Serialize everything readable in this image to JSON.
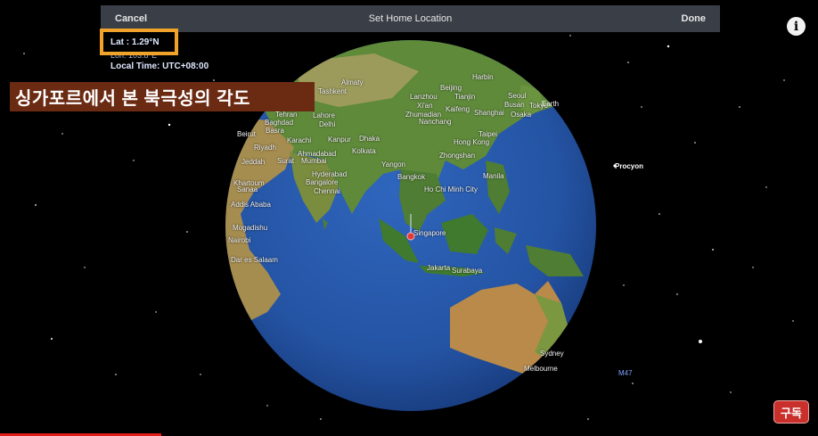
{
  "navbar": {
    "cancel_label": "Cancel",
    "title": "Set Home Location",
    "done_label": "Done"
  },
  "location": {
    "lat": "Lat : 1.29°N",
    "lon": "Lon: 103.8°E",
    "local_time": "Local Time: UTC+08:00"
  },
  "caption": "싱가포르에서 본 북극성의 각도",
  "info_icon": "i",
  "logo_text": "구독",
  "sky_labels": {
    "procyon": "Procyon",
    "m47": "M47",
    "earth": "Earth"
  },
  "colors": {
    "highlight_box": "#f0a22b",
    "caption_bg": "#6b2a12",
    "ocean": "#2453a3",
    "marker": "#e53935"
  },
  "cities": [
    "Almaty",
    "Tashkent",
    "Harbin",
    "Beijing",
    "Tianjin",
    "Seoul",
    "Busan",
    "Tokyo",
    "Lanzhou",
    "Xi'an",
    "Kaifeng",
    "Shanghai",
    "Osaka",
    "Zhumadian",
    "Nanchang",
    "Lahore",
    "Delhi",
    "Karachi",
    "Tehran",
    "Baghdad",
    "Basra",
    "Beirut",
    "Riyadh",
    "Jeddah",
    "Kanpur",
    "Dhaka",
    "Ahmadabad",
    "Surat",
    "Mumbai",
    "Kolkata",
    "Yangon",
    "Hong Kong",
    "Taipei",
    "Zhongshan",
    "Manila",
    "Hyderabad",
    "Bangalore",
    "Chennai",
    "Bangkok",
    "Ho Chi Minh City",
    "Khartoum",
    "Sanaa",
    "Addis Ababa",
    "Mogadishu",
    "Nairobi",
    "Dar es Salaam",
    "Singapore",
    "Jakarta",
    "Surabaya",
    "Sydney",
    "Melbourne"
  ]
}
